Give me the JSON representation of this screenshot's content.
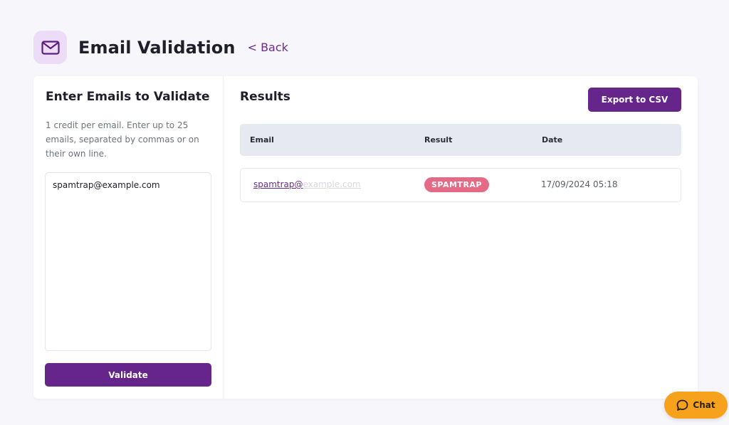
{
  "header": {
    "title": "Email Validation",
    "back_label": "< Back",
    "icon": "mail-icon"
  },
  "input_panel": {
    "title": "Enter Emails to Validate",
    "description": "1 credit per email. Enter up to 25 emails, separated by commas or on their own line.",
    "textarea_value": "spamtrap@example.com",
    "validate_label": "Validate"
  },
  "results_panel": {
    "title": "Results",
    "export_label": "Export to CSV",
    "columns": [
      "Email",
      "Result",
      "Date"
    ],
    "rows": [
      {
        "email_visible": "spamtrap@",
        "email_blurred": "example.com",
        "result": "SPAMTRAP",
        "date": "17/09/2024 05:18"
      }
    ]
  },
  "chat": {
    "label": "Chat",
    "icon": "chat-bubble-icon"
  },
  "colors": {
    "accent": "#66258a",
    "badge_spamtrap": "#e46a86",
    "chat": "#f6a21d",
    "icon_bg": "#ecdcf8"
  }
}
